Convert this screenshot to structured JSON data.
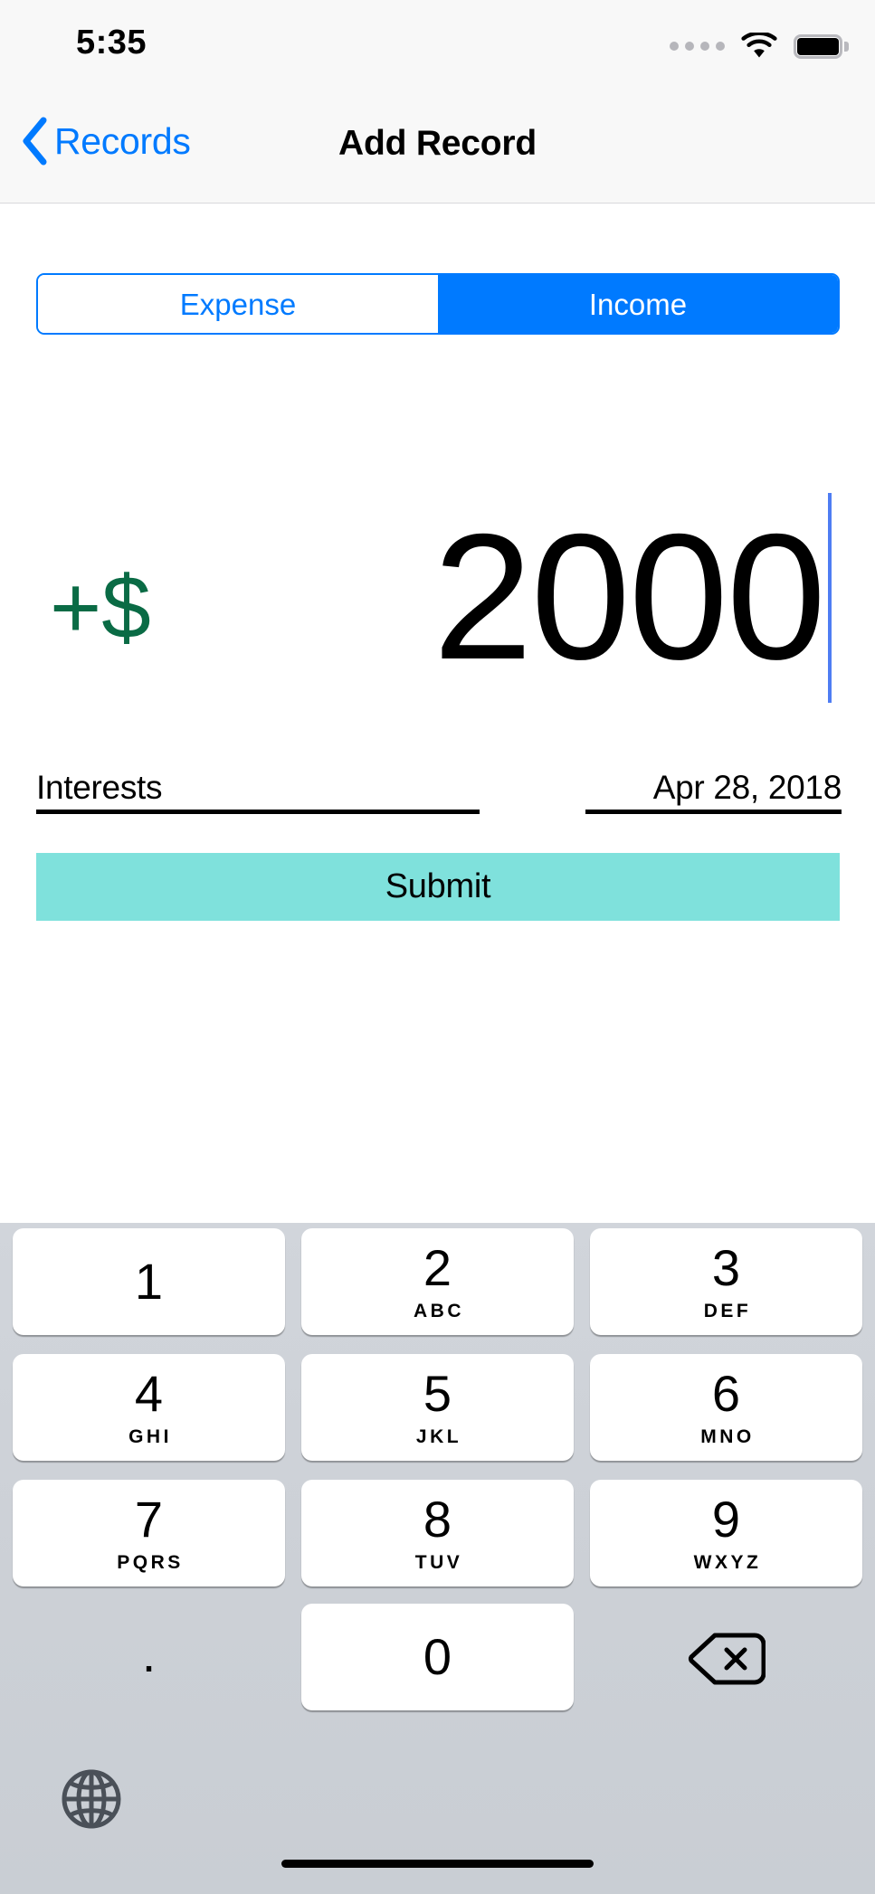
{
  "status_bar": {
    "time": "5:35",
    "signal_icon": "cellular-dots-icon",
    "wifi_icon": "wifi-icon",
    "battery_icon": "battery-full-icon"
  },
  "nav_bar": {
    "back_label": "Records",
    "back_icon": "chevron-left-icon",
    "title": "Add Record"
  },
  "segmented_control": {
    "options": [
      {
        "label": "Expense",
        "selected": false
      },
      {
        "label": "Income",
        "selected": true
      }
    ],
    "accent_color": "#007AFF"
  },
  "amount": {
    "sign_prefix": "+$",
    "sign_color": "#0A6B45",
    "value": "2000",
    "caret_color": "#4F7DF3"
  },
  "fields": {
    "note": {
      "value": "Interests"
    },
    "date": {
      "value": "Apr 28, 2018"
    }
  },
  "submit_button": {
    "label": "Submit",
    "background_color": "#7FE1DC"
  },
  "keyboard": {
    "type": "numeric-pad",
    "keys": [
      {
        "num": "1",
        "letters": ""
      },
      {
        "num": "2",
        "letters": "ABC"
      },
      {
        "num": "3",
        "letters": "DEF"
      },
      {
        "num": "4",
        "letters": "GHI"
      },
      {
        "num": "5",
        "letters": "JKL"
      },
      {
        "num": "6",
        "letters": "MNO"
      },
      {
        "num": "7",
        "letters": "PQRS"
      },
      {
        "num": "8",
        "letters": "TUV"
      },
      {
        "num": "9",
        "letters": "WXYZ"
      },
      {
        "num": "0",
        "letters": ""
      }
    ],
    "decimal_key": ".",
    "delete_icon": "backspace-delete-icon",
    "globe_icon": "globe-language-icon",
    "background_color": "#CDD1D7"
  },
  "home_indicator": {
    "visible": true
  }
}
